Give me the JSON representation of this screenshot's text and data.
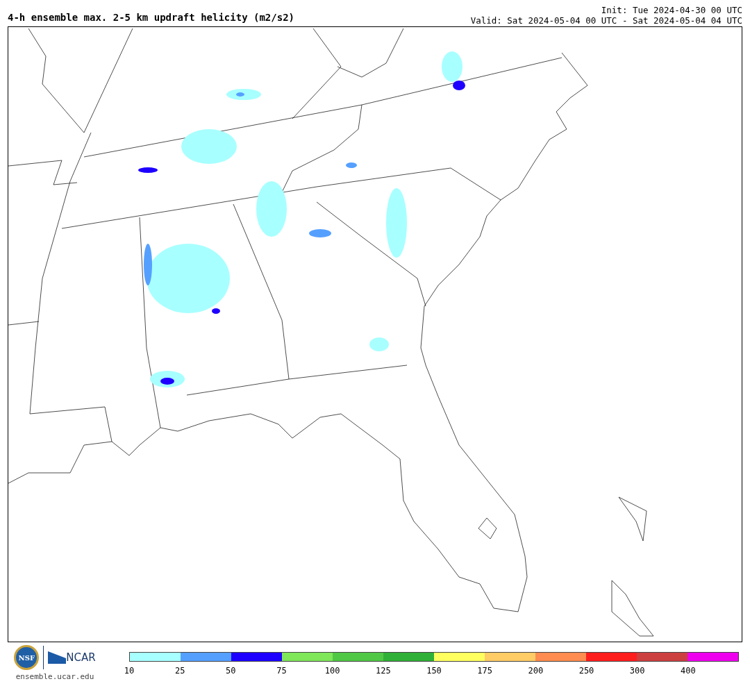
{
  "header": {
    "title": "4-h ensemble max. 2-5 km updraft helicity (m2/s2)",
    "init": "Init: Tue 2024-04-30 00 UTC",
    "valid": "Valid: Sat 2024-05-04 00 UTC - Sat 2024-05-04 04 UTC"
  },
  "logos": {
    "nsf": "NSF",
    "ncar": "NCAR",
    "url": "ensemble.ucar.edu"
  },
  "colorbar": {
    "bins": [
      {
        "color": "#a8ffff"
      },
      {
        "color": "#55a0ff"
      },
      {
        "color": "#1e00ff"
      },
      {
        "color": "#80e65a"
      },
      {
        "color": "#50c846"
      },
      {
        "color": "#30b038"
      },
      {
        "color": "#ffff60"
      },
      {
        "color": "#ffcc66"
      },
      {
        "color": "#ff8c50"
      },
      {
        "color": "#ff1e1e"
      },
      {
        "color": "#cc4040"
      },
      {
        "color": "#ee00ee"
      }
    ],
    "ticks": [
      "10",
      "25",
      "50",
      "75",
      "100",
      "125",
      "150",
      "175",
      "200",
      "250",
      "300",
      "400"
    ]
  }
}
